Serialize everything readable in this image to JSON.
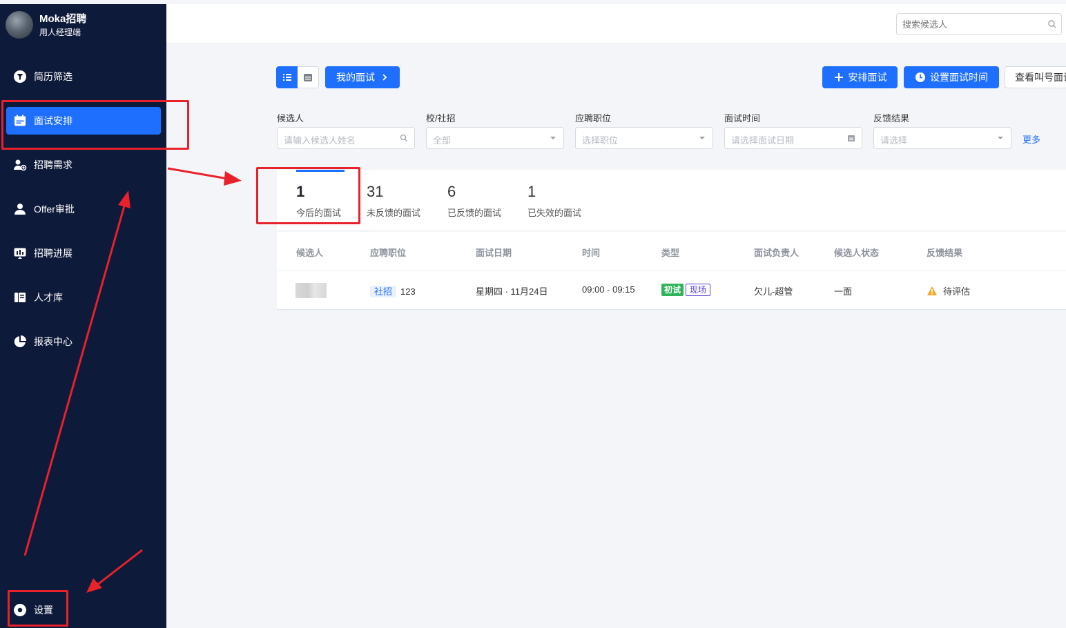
{
  "app": {
    "name": "Moka招聘",
    "subtitle": "用人经理端"
  },
  "sidebar": {
    "items": [
      {
        "label": "简历筛选",
        "icon": "filter-icon"
      },
      {
        "label": "面试安排",
        "icon": "calendar-icon",
        "active": true
      },
      {
        "label": "招聘需求",
        "icon": "user-add-icon"
      },
      {
        "label": "Offer审批",
        "icon": "user-icon"
      },
      {
        "label": "招聘进展",
        "icon": "progress-icon"
      },
      {
        "label": "人才库",
        "icon": "talent-icon"
      },
      {
        "label": "报表中心",
        "icon": "pie-chart-icon"
      }
    ],
    "settings": {
      "label": "设置",
      "icon": "settings-icon"
    }
  },
  "header": {
    "search_placeholder": "搜索候选人"
  },
  "toolbar": {
    "my_interviews": "我的面试",
    "arrange": "安排面试",
    "set_time": "设置面试时间",
    "call_number": "查看叫号面试"
  },
  "filters": {
    "candidate": {
      "label": "候选人",
      "placeholder": "请输入候选人姓名"
    },
    "type": {
      "label": "校/社招",
      "value": "全部"
    },
    "position": {
      "label": "应聘职位",
      "placeholder": "选择职位"
    },
    "time": {
      "label": "面试时间",
      "placeholder": "请选择面试日期"
    },
    "feedback": {
      "label": "反馈结果",
      "placeholder": "请选择"
    },
    "more": "更多"
  },
  "stats": [
    {
      "count": "1",
      "label": "今后的面试",
      "active": true
    },
    {
      "count": "31",
      "label": "未反馈的面试"
    },
    {
      "count": "6",
      "label": "已反馈的面试"
    },
    {
      "count": "1",
      "label": "已失效的面试"
    }
  ],
  "table": {
    "columns": [
      "候选人",
      "应聘职位",
      "面试日期",
      "时间",
      "类型",
      "面试负责人",
      "候选人状态",
      "反馈结果"
    ],
    "rows": [
      {
        "candidate": "",
        "position_tag": "社招",
        "position": "123",
        "date": "星期四 · 11月24日",
        "time": "09:00 - 09:15",
        "type_round": "初试",
        "type_mode": "现场",
        "owner": "欠儿-超管",
        "status": "一面",
        "feedback": "待评估"
      }
    ]
  },
  "colors": {
    "accent": "#1f6fff",
    "sidebar": "#0e1a3a",
    "annotation": "#e8212a",
    "warning": "#f5a623",
    "success": "#2fb45a"
  }
}
